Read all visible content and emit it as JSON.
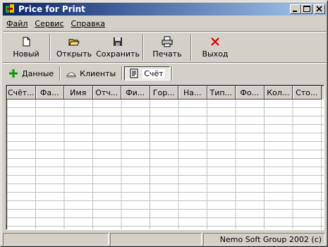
{
  "window": {
    "title": "Price for Print"
  },
  "menu": {
    "items": [
      {
        "label": "Файл",
        "underline": "Ф"
      },
      {
        "label": "Сервис",
        "underline": "С"
      },
      {
        "label": "Справка",
        "underline": "С"
      }
    ]
  },
  "toolbar": {
    "new_label": "Новый",
    "open_label": "Открыть",
    "save_label": "Сохранить",
    "print_label": "Печать",
    "exit_label": "Выход"
  },
  "tabs": {
    "data_label": "Данные",
    "clients_label": "Клиенты",
    "invoice_label": "Счёт"
  },
  "grid": {
    "columns": [
      "Счёт...",
      "Фа...",
      "Имя",
      "Отч...",
      "Фи...",
      "Гор...",
      "На...",
      "Тип...",
      "Фо...",
      "Кол...",
      "Сто..."
    ]
  },
  "status": {
    "panel1": "",
    "panel2": "",
    "panel3": "Nemo Soft Group 2002 (c)"
  },
  "colors": {
    "titlebar_start": "#0a246a",
    "titlebar_end": "#a6caf0",
    "face": "#d4d0c8",
    "exit_icon": "#e00000",
    "data_icon": "#00a000"
  },
  "icons": {
    "app": "printer-app-icon",
    "new": "new-document-icon",
    "open": "open-folder-icon",
    "save": "floppy-disk-icon",
    "print": "printer-icon",
    "exit": "red-x-icon",
    "data": "green-plus-icon",
    "clients": "clients-icon",
    "invoice": "document-icon"
  }
}
